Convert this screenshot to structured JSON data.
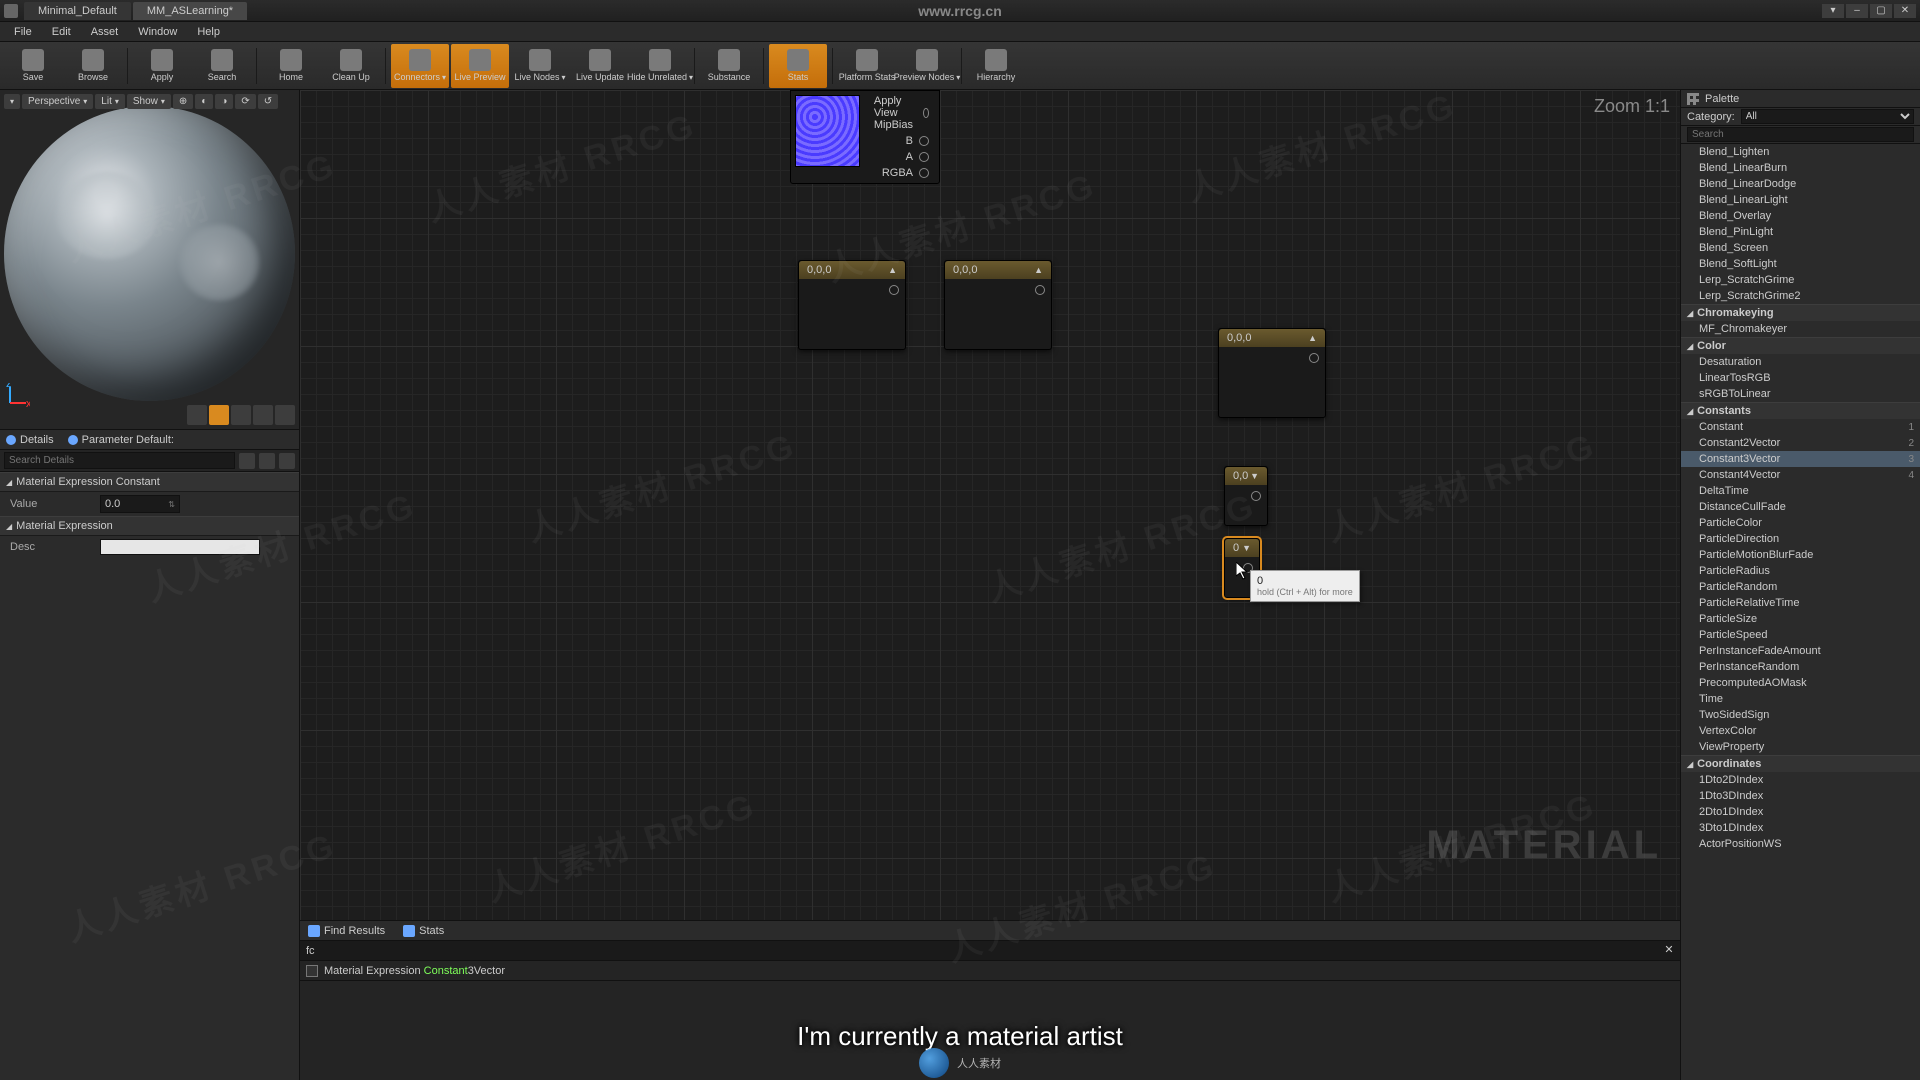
{
  "titlebar": {
    "tabs": [
      {
        "label": "Minimal_Default"
      },
      {
        "label": "MM_ASLearning*"
      }
    ],
    "url": "www.rrcg.cn"
  },
  "menu": [
    "File",
    "Edit",
    "Asset",
    "Window",
    "Help"
  ],
  "toolbar": [
    {
      "label": "Save",
      "icon": "save-icon"
    },
    {
      "label": "Browse",
      "icon": "browse-icon"
    },
    {
      "label": "Apply",
      "icon": "apply-icon"
    },
    {
      "label": "Search",
      "icon": "search-icon"
    },
    {
      "label": "Home",
      "icon": "home-icon"
    },
    {
      "label": "Clean Up",
      "icon": "clean-icon"
    },
    {
      "label": "Connectors",
      "icon": "connectors-icon",
      "active": true,
      "chev": true
    },
    {
      "label": "Live Preview",
      "icon": "livepreview-icon",
      "active": true
    },
    {
      "label": "Live Nodes",
      "icon": "livenodes-icon",
      "chev": true
    },
    {
      "label": "Live Update",
      "icon": "liveupdate-icon"
    },
    {
      "label": "Hide Unrelated",
      "icon": "hide-icon",
      "chev": true
    },
    {
      "label": "Substance",
      "icon": "substance-icon"
    },
    {
      "label": "Stats",
      "icon": "stats-icon",
      "active": true
    },
    {
      "label": "Platform Stats",
      "icon": "platform-icon"
    },
    {
      "label": "Preview Nodes",
      "icon": "preview-icon",
      "chev": true
    },
    {
      "label": "Hierarchy",
      "icon": "hierarchy-icon"
    }
  ],
  "viewport": {
    "buttons": [
      "▾",
      "Perspective",
      "Lit",
      "Show"
    ]
  },
  "panels": {
    "details": "Details",
    "paramdef": "Parameter Default:",
    "search_placeholder": "Search Details"
  },
  "props": {
    "sec1": "Material Expression Constant",
    "value_label": "Value",
    "value": "0.0",
    "sec2": "Material Expression",
    "desc_label": "Desc"
  },
  "graph": {
    "zoom": "Zoom 1:1",
    "watermark": "MATERIAL",
    "texnode": {
      "r0": "Apply View MipBias",
      "rB": "B",
      "rA": "A",
      "rRGBA": "RGBA"
    },
    "nodes": {
      "v3a": "0,0,0",
      "v3b": "0,0,0",
      "v3c": "0,0,0",
      "v2": "0,0",
      "v1": "0"
    },
    "tooltip": {
      "line1": "0",
      "line2": "hold (Ctrl + Alt) for more"
    }
  },
  "bottom": {
    "find": "Find Results",
    "stats": "Stats",
    "query": "fc",
    "result_pre": "Material Expression ",
    "result_hl": "Constant",
    "result_post": "3Vector"
  },
  "palette": {
    "title": "Palette",
    "cat_label": "Category:",
    "cat_value": "All",
    "search_placeholder": "Search",
    "items": [
      {
        "t": "item",
        "label": "Blend_Lighten"
      },
      {
        "t": "item",
        "label": "Blend_LinearBurn"
      },
      {
        "t": "item",
        "label": "Blend_LinearDodge"
      },
      {
        "t": "item",
        "label": "Blend_LinearLight"
      },
      {
        "t": "item",
        "label": "Blend_Overlay"
      },
      {
        "t": "item",
        "label": "Blend_PinLight"
      },
      {
        "t": "item",
        "label": "Blend_Screen"
      },
      {
        "t": "item",
        "label": "Blend_SoftLight"
      },
      {
        "t": "item",
        "label": "Lerp_ScratchGrime"
      },
      {
        "t": "item",
        "label": "Lerp_ScratchGrime2"
      },
      {
        "t": "cat",
        "label": "Chromakeying"
      },
      {
        "t": "item",
        "label": "MF_Chromakeyer"
      },
      {
        "t": "cat",
        "label": "Color"
      },
      {
        "t": "item",
        "label": "Desaturation"
      },
      {
        "t": "item",
        "label": "LinearTosRGB"
      },
      {
        "t": "item",
        "label": "sRGBToLinear"
      },
      {
        "t": "cat",
        "label": "Constants"
      },
      {
        "t": "item",
        "label": "Constant",
        "sc": "1"
      },
      {
        "t": "item",
        "label": "Constant2Vector",
        "sc": "2"
      },
      {
        "t": "item",
        "label": "Constant3Vector",
        "sc": "3",
        "sel": true
      },
      {
        "t": "item",
        "label": "Constant4Vector",
        "sc": "4"
      },
      {
        "t": "item",
        "label": "DeltaTime"
      },
      {
        "t": "item",
        "label": "DistanceCullFade"
      },
      {
        "t": "item",
        "label": "ParticleColor"
      },
      {
        "t": "item",
        "label": "ParticleDirection"
      },
      {
        "t": "item",
        "label": "ParticleMotionBlurFade"
      },
      {
        "t": "item",
        "label": "ParticleRadius"
      },
      {
        "t": "item",
        "label": "ParticleRandom"
      },
      {
        "t": "item",
        "label": "ParticleRelativeTime"
      },
      {
        "t": "item",
        "label": "ParticleSize"
      },
      {
        "t": "item",
        "label": "ParticleSpeed"
      },
      {
        "t": "item",
        "label": "PerInstanceFadeAmount"
      },
      {
        "t": "item",
        "label": "PerInstanceRandom"
      },
      {
        "t": "item",
        "label": "PrecomputedAOMask"
      },
      {
        "t": "item",
        "label": "Time"
      },
      {
        "t": "item",
        "label": "TwoSidedSign"
      },
      {
        "t": "item",
        "label": "VertexColor"
      },
      {
        "t": "item",
        "label": "ViewProperty"
      },
      {
        "t": "cat",
        "label": "Coordinates"
      },
      {
        "t": "item",
        "label": "1Dto2DIndex"
      },
      {
        "t": "item",
        "label": "1Dto3DIndex"
      },
      {
        "t": "item",
        "label": "2Dto1DIndex"
      },
      {
        "t": "item",
        "label": "3Dto1DIndex"
      },
      {
        "t": "item",
        "label": "ActorPositionWS"
      }
    ]
  },
  "subtitle": "I'm currently a material artist",
  "centermark": "人人素材"
}
